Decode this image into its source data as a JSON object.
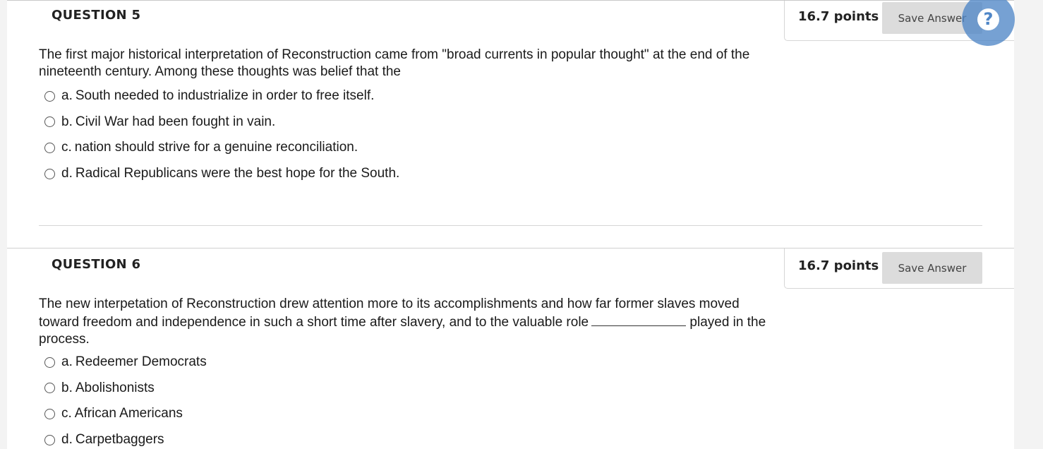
{
  "questions": [
    {
      "title": "QUESTION 5",
      "points": "16.7 points",
      "save_label": "Save Answer",
      "text": "The first major historical interpretation of Reconstruction came from \"broad currents in popular thought\" at the end of the nineteenth century. Among these thoughts was belief that the",
      "options": [
        {
          "letter": "a.",
          "text": "South needed to industrialize in order to free itself."
        },
        {
          "letter": "b.",
          "text": "Civil War had been fought in vain."
        },
        {
          "letter": "c.",
          "text": "nation should strive for a genuine reconciliation."
        },
        {
          "letter": "d.",
          "text": "Radical Republicans were the best hope for the South."
        }
      ]
    },
    {
      "title": "QUESTION 6",
      "points": "16.7 points",
      "save_label": "Save Answer",
      "text_before_blank": "The new interpetation of Reconstruction drew attention more to its accomplishments and how far former slaves moved toward freedom and independence in such a short time after slavery, and to the valuable role",
      "text_after_blank": "played in the process.",
      "options": [
        {
          "letter": "a.",
          "text": "Redeemer Democrats"
        },
        {
          "letter": "b.",
          "text": "Abolishonists"
        },
        {
          "letter": "c.",
          "text": "African Americans"
        },
        {
          "letter": "d.",
          "text": "Carpetbaggers"
        }
      ]
    }
  ],
  "help": {
    "glyph": "?"
  },
  "colors": {
    "accent": "#4f86c7",
    "button_bg": "#dcdcdc"
  }
}
